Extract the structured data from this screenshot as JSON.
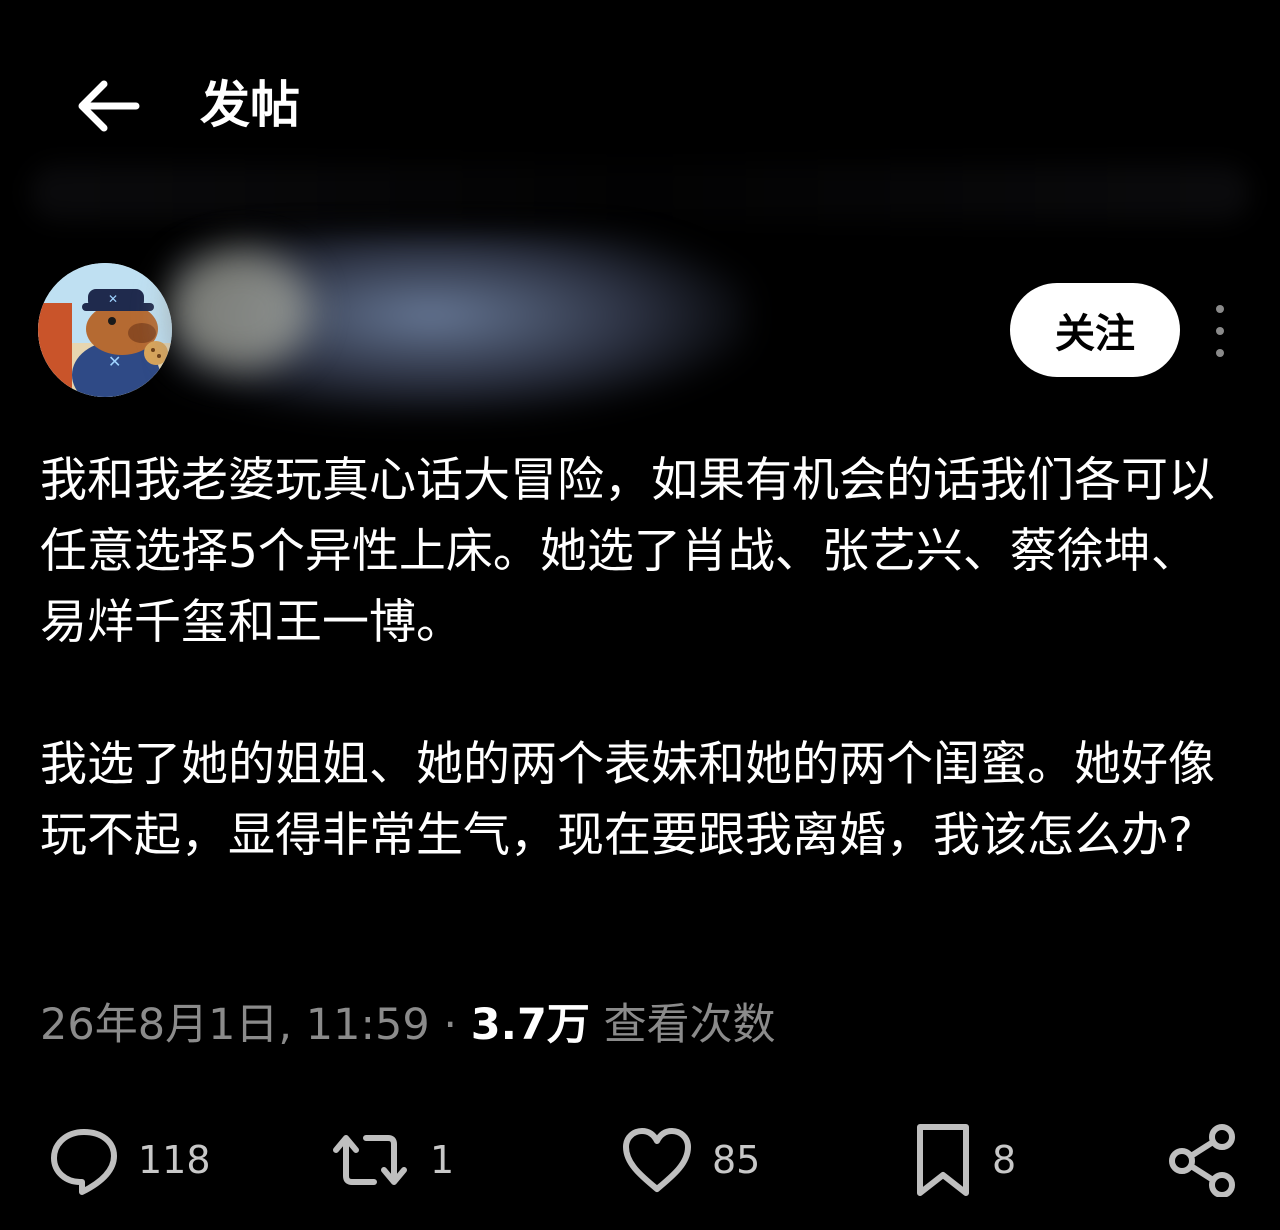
{
  "header": {
    "title": "发帖",
    "back_icon": "arrow-left-icon"
  },
  "author": {
    "avatar": "capybara-avatar",
    "follow_label": "关注",
    "more_icon": "more-vertical-icon"
  },
  "post": {
    "paragraphs": [
      "我和我老婆玩真心话大冒险，如果有机会的话我们各可以任意选择5个异性上床。她选了肖战、张艺兴、蔡徐坤、易烊千玺和王一博。",
      "我选了她的姐姐、她的两个表妹和她的两个闺蜜。她好像玩不起，显得非常生气，现在要跟我离婚，我该怎么办?"
    ],
    "date": "26年8月1日, 11:59",
    "separator": "·",
    "views": "3.7万",
    "views_label": "查看次数"
  },
  "actions": {
    "replies": "118",
    "retweets": "1",
    "likes": "85",
    "bookmarks": "8"
  },
  "colors": {
    "background": "#000000",
    "text": "#ffffff",
    "muted": "#8b8b8b",
    "follow_bg": "#ffffff"
  }
}
